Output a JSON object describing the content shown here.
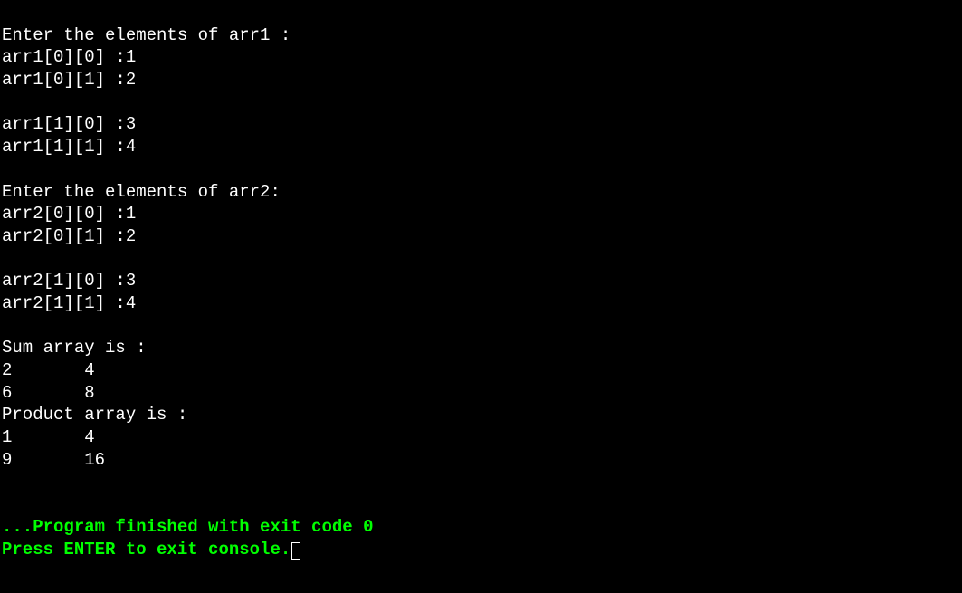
{
  "prompts": {
    "enter_arr1": "Enter the elements of arr1 :",
    "enter_arr2": "Enter the elements of arr2:",
    "sum_header": "Sum array is :",
    "product_header": "Product array is :"
  },
  "arr1_inputs": [
    "arr1[0][0] :1",
    "arr1[0][1] :2",
    "",
    "arr1[1][0] :3",
    "arr1[1][1] :4"
  ],
  "arr2_inputs": [
    "arr2[0][0] :1",
    "arr2[0][1] :2",
    "",
    "arr2[1][0] :3",
    "arr2[1][1] :4"
  ],
  "sum_array": [
    "2       4",
    "6       8"
  ],
  "product_array": [
    "1       4",
    "9       16"
  ],
  "exit_message": "...Program finished with exit code 0",
  "press_enter": "Press ENTER to exit console."
}
